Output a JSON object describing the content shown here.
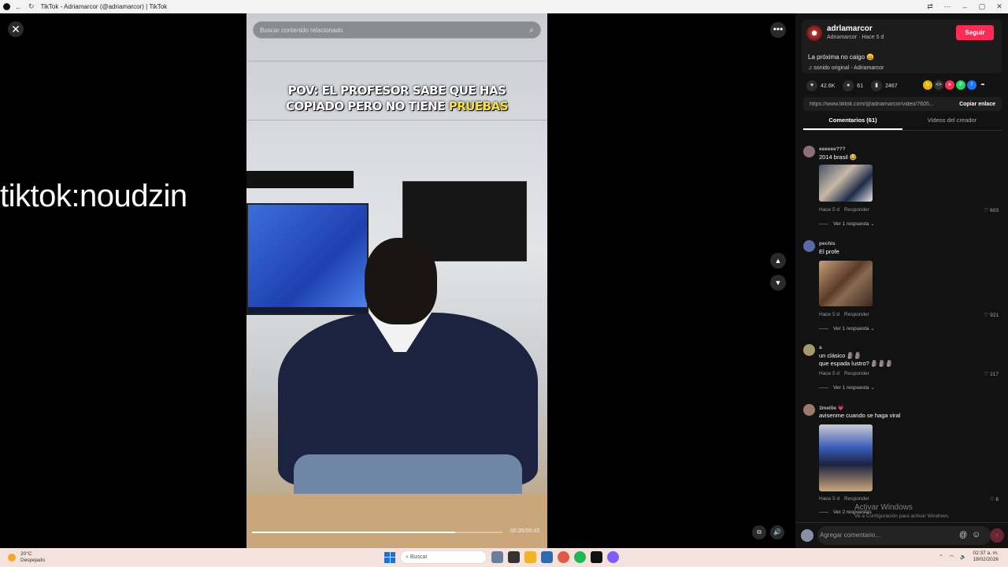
{
  "browser": {
    "title": "TikTok - Adriamarcor (@adriamarcor) | TikTok"
  },
  "overlay": {
    "watermark_text": "tiktok:noudzin"
  },
  "video": {
    "search_placeholder": "Buscar contenido relacionado",
    "caption_line1": "POV: EL PROFESOR SABE QUE HAS",
    "caption_line2_prefix": "COPIADO PERO NO TIENE ",
    "caption_highlight": "PRUEBAS",
    "time": "00:35/00:43",
    "progress_fraction": 0.81
  },
  "author": {
    "username": "adrlamarcor",
    "subtitle": "Adriamarcor · Hace 5 d",
    "follow_label": "Seguir",
    "description": "La próxima no caigo 😄",
    "sound": "♫  sonido original - Adriamarcor"
  },
  "stats": {
    "likes": "42.6K",
    "comments": "61",
    "saves": "2467"
  },
  "link": {
    "url": "https://www.tiktok.com/@adriamarcor/video/7605...",
    "copy_label": "Copiar enlace"
  },
  "tabs": [
    {
      "label": "Comentarios (61)"
    },
    {
      "label": "Videos del creador"
    }
  ],
  "comments": [
    {
      "user": "eeeeee???",
      "text": "2014 brasil 😂",
      "time": "Hace 5 d",
      "reply": "Responder",
      "likes": "603",
      "replies": "Ver 1 respuesta ⌄"
    },
    {
      "user": "pechis",
      "text": "El profe",
      "time": "Hace 5 d",
      "reply": "Responder",
      "likes": "921",
      "replies": "Ver 1 respuesta ⌄"
    },
    {
      "user": "a",
      "text": "un clásico 🗿🗿",
      "text2": "que espada lustro? 🗿🗿🗿",
      "time": "Hace 5 d",
      "reply": "Responder",
      "likes": "217",
      "replies": "Ver 1 respuesta ⌄"
    },
    {
      "user": "3mellie 💗",
      "text": "avisenme cuando se haga viral",
      "time": "Hace 5 d",
      "reply": "Responder",
      "likes": "8",
      "replies": "Ver 2 respuestas"
    }
  ],
  "windows_watermark": {
    "line1": "Activar Windows",
    "line2": "Ve a Configuración para activar Windows."
  },
  "comment_input": {
    "placeholder": "Agregar comentario..."
  },
  "taskbar": {
    "temperature": "20°C",
    "weather": "Despejado",
    "search_label": "Buscar",
    "time": "02:37 a. m.",
    "date": "18/02/2026"
  },
  "colors": {
    "follow": "#fe2c55",
    "caption_highlight": "#f7e030"
  }
}
